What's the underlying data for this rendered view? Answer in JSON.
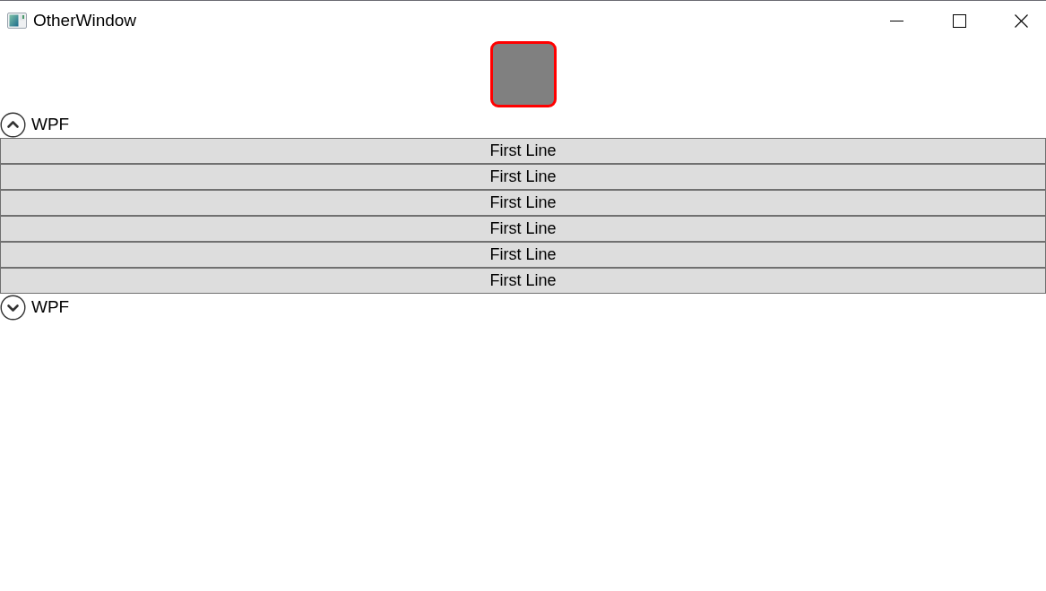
{
  "window": {
    "title": "OtherWindow"
  },
  "expanders": [
    {
      "header": "WPF",
      "expanded": true,
      "items": [
        {
          "label": "First Line"
        },
        {
          "label": "First Line"
        },
        {
          "label": "First Line"
        },
        {
          "label": "First Line"
        },
        {
          "label": "First Line"
        },
        {
          "label": "First Line"
        }
      ]
    },
    {
      "header": "WPF",
      "expanded": false
    }
  ]
}
